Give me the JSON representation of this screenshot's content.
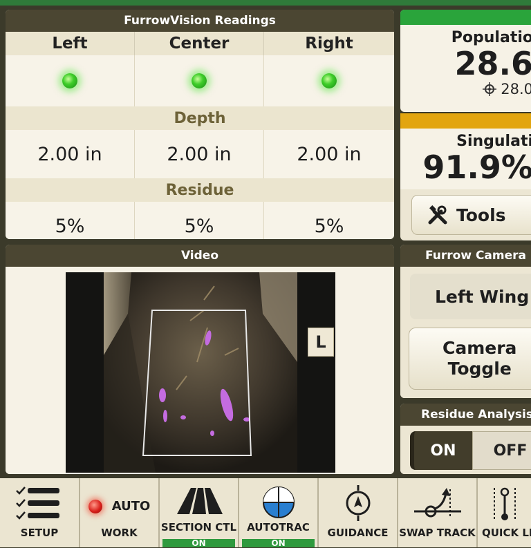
{
  "furrowvision": {
    "title": "FurrowVision Readings",
    "columns": [
      "Left",
      "Center",
      "Right"
    ],
    "depth_label": "Depth",
    "depth_values": [
      "2.00 in",
      "2.00 in",
      "2.00 in"
    ],
    "residue_label": "Residue",
    "residue_values": [
      "5%",
      "5%",
      "5%"
    ]
  },
  "population": {
    "label": "Populatio",
    "value": "28.6",
    "target": "28.0",
    "status_color": "#2aa43b"
  },
  "singulation": {
    "label": "Singulati",
    "value": "91.9%",
    "status_color": "#e2a50f"
  },
  "tools": {
    "label": "Tools"
  },
  "video": {
    "title": "Video",
    "wing_badge": "L"
  },
  "furrow_camera": {
    "title": "Furrow Camera",
    "wing_name": "Left Wing",
    "toggle_line1": "Camera",
    "toggle_line2": "Toggle"
  },
  "residue_analysis": {
    "title": "Residue Analysis",
    "on_label": "ON",
    "off_label": "OFF",
    "selected": "ON"
  },
  "bottombar": {
    "setup": "SETUP",
    "auto": "AUTO",
    "work": "WORK",
    "section_ctl": "SECTION CTL",
    "section_ctl_status": "ON",
    "autotrac": "AUTOTRAC",
    "autotrac_status": "ON",
    "guidance": "GUIDANCE",
    "swap_track": "SWAP TRACK",
    "quick_li": "QUICK LI"
  }
}
